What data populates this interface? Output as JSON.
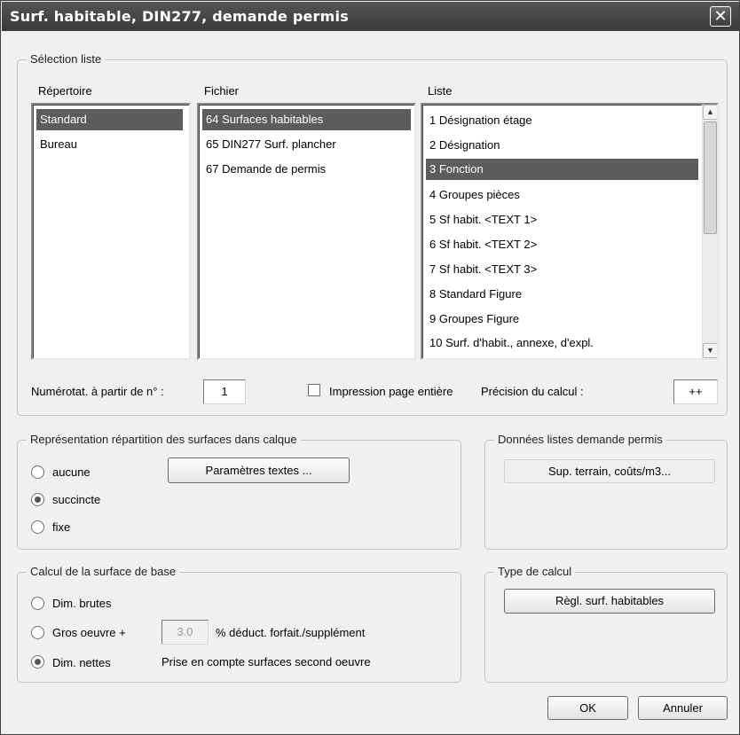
{
  "window": {
    "title": "Surf. habitable, DIN277, demande permis",
    "close_glyph": "✕"
  },
  "selection": {
    "legend": "Sélection liste",
    "repertoire": {
      "header": "Répertoire",
      "items": [
        "Standard",
        "Bureau"
      ],
      "selected": 0
    },
    "fichier": {
      "header": "Fichier",
      "items": [
        "64 Surfaces habitables",
        "65 DIN277 Surf. plancher",
        "67 Demande de permis"
      ],
      "selected": 0
    },
    "liste": {
      "header": "Liste",
      "items": [
        "1 Désignation étage",
        "2 Désignation",
        "3 Fonction",
        "4 Groupes pièces",
        "5 Sf habit. <TEXT 1>",
        "6 Sf habit. <TEXT 2>",
        "7 Sf habit. <TEXT 3>",
        "8 Standard Figure",
        "9 Groupes Figure",
        "10 Surf. d'habit., annexe, d'expl."
      ],
      "selected": 2
    },
    "numerotation_label": "Numérotat. à partir de n° :",
    "numerotation_value": "1",
    "impression_label": "Impression page entière",
    "impression_checked": false,
    "precision_label": "Précision du calcul :",
    "precision_value": "++"
  },
  "representation": {
    "legend": "Représentation répartition des surfaces dans calque",
    "options": [
      "aucune",
      "succincte",
      "fixe"
    ],
    "selected": 1,
    "button_label": "Paramètres textes ..."
  },
  "donnees": {
    "legend": "Données listes demande permis",
    "button_label": "Sup. terrain, coûts/m3..."
  },
  "calcul_base": {
    "legend": "Calcul de la surface de base",
    "options": [
      "Dim. brutes",
      "Gros oeuvre +",
      "Dim. nettes"
    ],
    "selected": 2,
    "deduction_value": "3.0",
    "deduction_label": "% déduct. forfait./supplément",
    "nettes_note": "Prise en compte surfaces second oeuvre"
  },
  "type_calcul": {
    "legend": "Type de calcul",
    "button_label": "Règl. surf. habitables"
  },
  "footer": {
    "ok_label": "OK",
    "cancel_label": "Annuler"
  }
}
